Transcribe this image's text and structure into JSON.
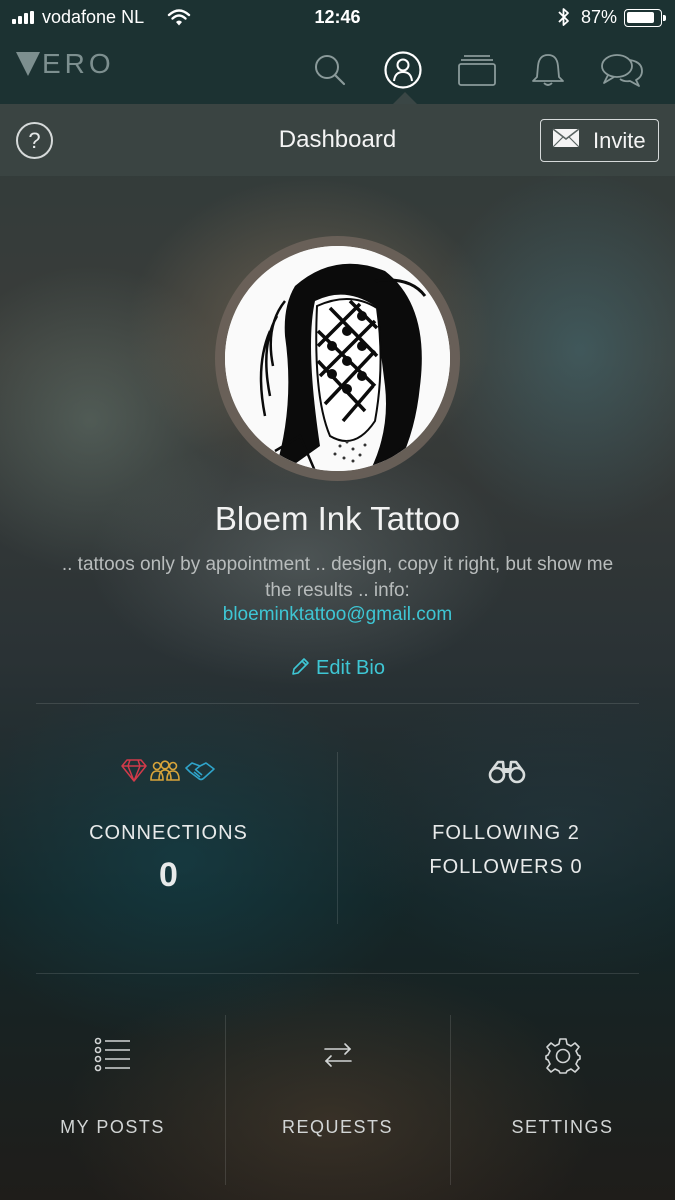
{
  "status_bar": {
    "carrier": "vodafone NL",
    "time": "12:46",
    "battery_percent": "87%",
    "battery_level": 0.87,
    "icons": [
      "signal-icon",
      "wifi-icon",
      "bluetooth-icon",
      "battery-icon"
    ]
  },
  "nav": {
    "logo_text": "ERO",
    "tabs": [
      {
        "icon": "search-icon"
      },
      {
        "icon": "profile-icon",
        "active": true
      },
      {
        "icon": "collections-icon"
      },
      {
        "icon": "bell-icon"
      },
      {
        "icon": "chat-icon"
      }
    ]
  },
  "header": {
    "help_label": "?",
    "title": "Dashboard",
    "invite_label": "Invite"
  },
  "profile": {
    "name": "Bloem Ink Tattoo",
    "bio": ".. tattoos only by appointment .. design, copy it right, but show me the results .. info:",
    "email": "bloeminktattoo@gmail.com",
    "edit_bio_label": "Edit Bio"
  },
  "stats": {
    "connections_label": "CONNECTIONS",
    "connections_count": "0",
    "following_text": "FOLLOWING 2",
    "followers_text": "FOLLOWERS 0"
  },
  "actions": [
    {
      "label": "MY POSTS",
      "icon": "list-icon"
    },
    {
      "label": "REQUESTS",
      "icon": "swap-arrows-icon"
    },
    {
      "label": "SETTINGS",
      "icon": "gear-icon"
    }
  ],
  "colors": {
    "accent": "#3ec6d4",
    "bar_background": "#1c3232",
    "diamond": "#d23a4a",
    "friends": "#d8a43a",
    "handshake": "#2fa3c9"
  }
}
